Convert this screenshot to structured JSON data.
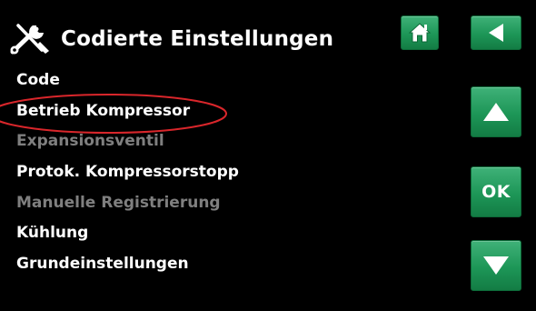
{
  "header": {
    "title": "Codierte Einstellungen",
    "icon": "wrench-screwdriver-icon"
  },
  "menu": {
    "items": [
      {
        "label": "Code",
        "enabled": true
      },
      {
        "label": "Betrieb Kompressor",
        "enabled": true,
        "circled": true
      },
      {
        "label": "Expansionsventil",
        "enabled": false
      },
      {
        "label": "Protok. Kompressorstopp",
        "enabled": true
      },
      {
        "label": "Manuelle Registrierung",
        "enabled": false
      },
      {
        "label": "Kühlung",
        "enabled": true
      },
      {
        "label": "Grundeinstellungen",
        "enabled": true
      }
    ]
  },
  "buttons": {
    "home_icon": "home-icon",
    "back_icon": "back-arrow-icon",
    "up_icon": "up-arrow-icon",
    "ok_label": "OK",
    "down_icon": "down-arrow-icon"
  },
  "colors": {
    "background": "#000000",
    "text": "#ffffff",
    "disabled_text": "#7f7f7f",
    "button_green": "#1d9657",
    "highlight_circle": "#d9262b"
  }
}
